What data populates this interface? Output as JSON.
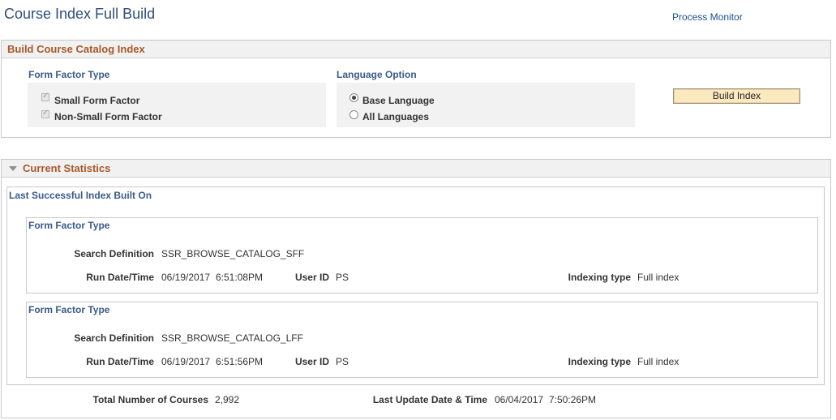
{
  "page": {
    "title": "Course Index Full Build",
    "process_monitor_link": "Process Monitor"
  },
  "build_section": {
    "title": "Build Course Catalog Index",
    "form_factor": {
      "label": "Form Factor Type",
      "options": [
        {
          "label": "Small Form Factor",
          "checked": true,
          "disabled": true
        },
        {
          "label": "Non-Small Form Factor",
          "checked": true,
          "disabled": true
        }
      ]
    },
    "language": {
      "label": "Language Option",
      "selected": "Base Language",
      "options": [
        {
          "label": "Base Language"
        },
        {
          "label": "All Languages"
        }
      ]
    },
    "build_button": "Build Index"
  },
  "stats_section": {
    "title": "Current Statistics",
    "last_built_label": "Last Successful Index Built On",
    "blocks": [
      {
        "heading": "Form Factor Type",
        "search_def_label": "Search Definition",
        "search_def": "SSR_BROWSE_CATALOG_SFF",
        "run_label": "Run Date/Time",
        "run_date": "06/19/2017",
        "run_time": "6:51:08PM",
        "user_label": "User ID",
        "user": "PS",
        "indexing_label": "Indexing type",
        "indexing": "Full index"
      },
      {
        "heading": "Form Factor Type",
        "search_def_label": "Search Definition",
        "search_def": "SSR_BROWSE_CATALOG_LFF",
        "run_label": "Run Date/Time",
        "run_date": "06/19/2017",
        "run_time": "6:51:56PM",
        "user_label": "User ID",
        "user": "PS",
        "indexing_label": "Indexing type",
        "indexing": "Full index"
      }
    ],
    "total_label": "Total Number of Courses",
    "total": "2,992",
    "last_update_label": "Last Update Date & Time",
    "last_update_date": "06/04/2017",
    "last_update_time": "7:50:26PM"
  },
  "colors": {
    "title": "#2e4d7b",
    "section_title": "#a9582a",
    "group_label": "#3a5a8a",
    "button_bg": "#fde9bf"
  }
}
